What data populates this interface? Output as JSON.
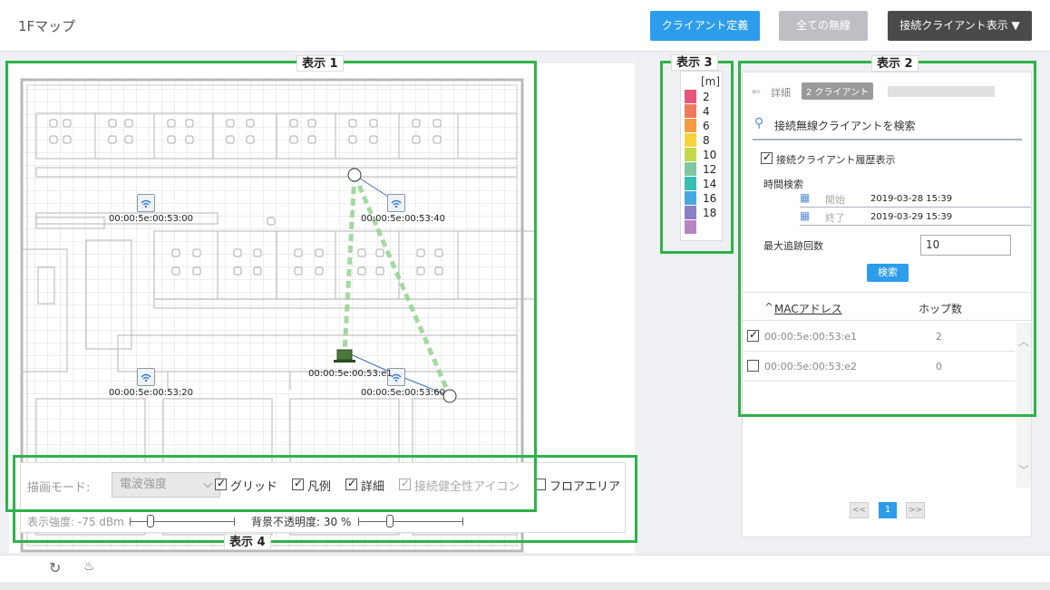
{
  "header": {
    "title": "1Fマップ",
    "btn_define": "クライアント定義",
    "btn_all_wireless": "全ての無線",
    "btn_connected": "接続クライアント表示 ▼"
  },
  "tags": {
    "t1": "表示 1",
    "t2": "表示 2",
    "t3": "表示 3",
    "t4": "表示 4"
  },
  "map": {
    "access_points": [
      {
        "label": "00:00:5e:00:53:00"
      },
      {
        "label": "00:00:5e:00:53:40"
      },
      {
        "label": "00:00:5e:00:53:20"
      },
      {
        "label": "00:00:5e:00:53:60"
      }
    ],
    "client_label": "00:00:5e:00:53:e1"
  },
  "legend": {
    "unit": "[m]",
    "items": [
      {
        "value": "2",
        "color": "#e8547a"
      },
      {
        "value": "4",
        "color": "#ef7b5b"
      },
      {
        "value": "6",
        "color": "#f39c45"
      },
      {
        "value": "8",
        "color": "#f5d43b"
      },
      {
        "value": "10",
        "color": "#c4d84a"
      },
      {
        "value": "12",
        "color": "#7fc8a0"
      },
      {
        "value": "14",
        "color": "#37bdb1"
      },
      {
        "value": "16",
        "color": "#47a9e0"
      },
      {
        "value": "18",
        "color": "#8c7fc4"
      }
    ],
    "last_color": "#b784c4"
  },
  "panel": {
    "details": "詳細",
    "client_badge": "2 クライアント",
    "search_placeholder": "接続無線クライアントを検索",
    "history_label": "接続クライアント履歴表示",
    "time_search": "時間検索",
    "start_label": "開始",
    "start_value": "2019-03-28 15:39",
    "end_label": "終了",
    "end_value": "2019-03-29 15:39",
    "max_trace_label": "最大追跡回数",
    "max_trace_value": "10",
    "search_btn": "検索",
    "col_mac": "MACアドレス",
    "col_hops": "ホップ数",
    "rows": [
      {
        "mac": "00:00:5e:00:53:e1",
        "hops": "2",
        "checked": true
      },
      {
        "mac": "00:00:5e:00:53:e2",
        "hops": "0",
        "checked": false
      }
    ],
    "pager": {
      "prev": "<<",
      "page": "1",
      "next": ">>"
    }
  },
  "controls": {
    "draw_mode_label": "描画モード:",
    "draw_mode_value": "電波強度",
    "grid": "グリッド",
    "legend": "凡例",
    "details": "詳細",
    "health_icon": "接続健全性アイコン",
    "floor_area": "フロアエリア",
    "strength_label": "表示強度: -75 dBm",
    "opacity_label": "背景不透明度: 30 %",
    "strength_level": 0.2,
    "opacity_level": 0.3
  }
}
